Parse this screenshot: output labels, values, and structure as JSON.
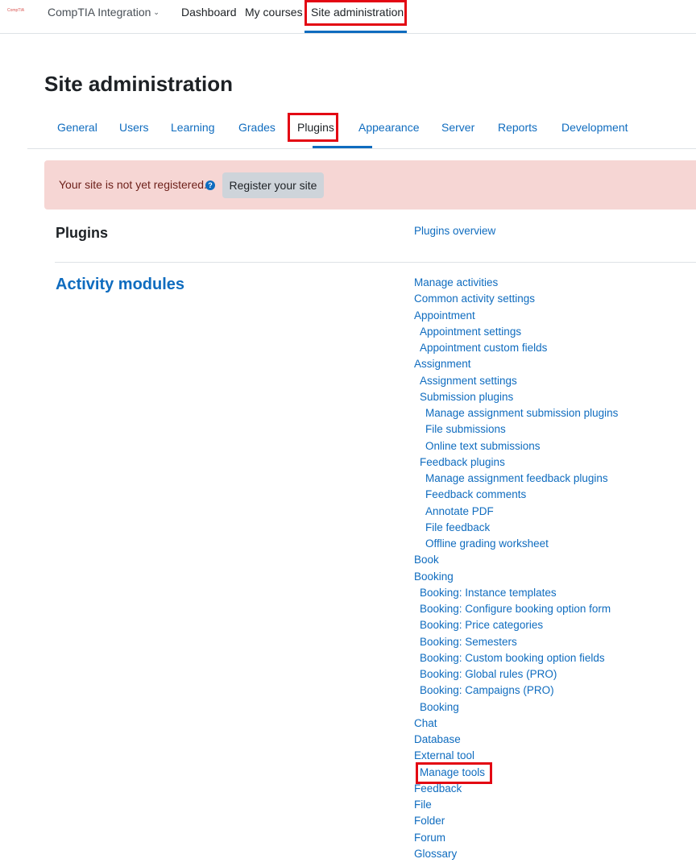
{
  "topnav": {
    "logo_text": "CompTIA",
    "site_name": "CompTIA Integration",
    "links": [
      "Dashboard",
      "My courses",
      "Site administration"
    ]
  },
  "page": {
    "title": "Site administration"
  },
  "tabs": [
    "General",
    "Users",
    "Learning",
    "Grades",
    "Plugins",
    "Appearance",
    "Server",
    "Reports",
    "Development"
  ],
  "alert": {
    "message": "Your site is not yet registered.",
    "button": "Register your site"
  },
  "plugins_section": {
    "heading": "Plugins",
    "link": "Plugins overview"
  },
  "activity_modules": {
    "heading": "Activity modules",
    "links": [
      "Manage activities",
      "Common activity settings",
      "Appointment",
      "Appointment settings",
      "Appointment custom fields",
      "Assignment",
      "Assignment settings",
      "Submission plugins",
      "Manage assignment submission plugins",
      "File submissions",
      "Online text submissions",
      "Feedback plugins",
      "Manage assignment feedback plugins",
      "Feedback comments",
      "Annotate PDF",
      "File feedback",
      "Offline grading worksheet",
      "Book",
      "Booking",
      "Booking: Instance templates",
      "Booking: Configure booking option form",
      "Booking: Price categories",
      "Booking: Semesters",
      "Booking: Custom booking option fields",
      "Booking: Global rules (PRO)",
      "Booking: Campaigns (PRO)",
      "Booking",
      "Chat",
      "Database",
      "External tool",
      "Manage tools",
      "Feedback",
      "File",
      "Folder",
      "Forum",
      "Glossary"
    ]
  },
  "colors": {
    "link": "#0f6cbf",
    "highlight": "#e30613",
    "alert_bg": "#f6d6d4"
  }
}
